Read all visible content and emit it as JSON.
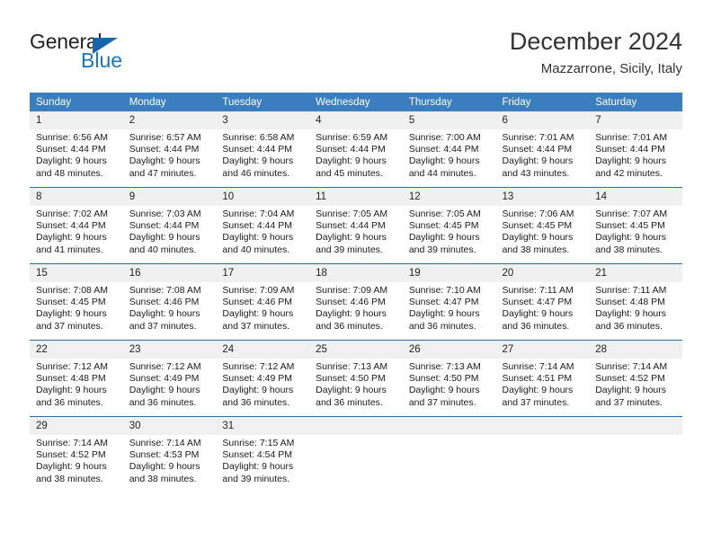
{
  "branding": {
    "name_top": "General",
    "name_bottom": "Blue",
    "accent_color": "#1b75bb",
    "triangle_color": "#1566ac"
  },
  "header": {
    "title": "December 2024",
    "location": "Mazzarrone, Sicily, Italy"
  },
  "theme": {
    "header_row_background": "#3a7ebf",
    "header_row_text": "#ffffff",
    "daynum_background": "#f0f0f0",
    "week_divider": "#2e6da4",
    "page_background": "#ffffff"
  },
  "weekday_headers": [
    "Sunday",
    "Monday",
    "Tuesday",
    "Wednesday",
    "Thursday",
    "Friday",
    "Saturday"
  ],
  "days": [
    {
      "day": "1",
      "sunrise": "Sunrise: 6:56 AM",
      "sunset": "Sunset: 4:44 PM",
      "daylight_1": "Daylight: 9 hours",
      "daylight_2": "and 48 minutes."
    },
    {
      "day": "2",
      "sunrise": "Sunrise: 6:57 AM",
      "sunset": "Sunset: 4:44 PM",
      "daylight_1": "Daylight: 9 hours",
      "daylight_2": "and 47 minutes."
    },
    {
      "day": "3",
      "sunrise": "Sunrise: 6:58 AM",
      "sunset": "Sunset: 4:44 PM",
      "daylight_1": "Daylight: 9 hours",
      "daylight_2": "and 46 minutes."
    },
    {
      "day": "4",
      "sunrise": "Sunrise: 6:59 AM",
      "sunset": "Sunset: 4:44 PM",
      "daylight_1": "Daylight: 9 hours",
      "daylight_2": "and 45 minutes."
    },
    {
      "day": "5",
      "sunrise": "Sunrise: 7:00 AM",
      "sunset": "Sunset: 4:44 PM",
      "daylight_1": "Daylight: 9 hours",
      "daylight_2": "and 44 minutes."
    },
    {
      "day": "6",
      "sunrise": "Sunrise: 7:01 AM",
      "sunset": "Sunset: 4:44 PM",
      "daylight_1": "Daylight: 9 hours",
      "daylight_2": "and 43 minutes."
    },
    {
      "day": "7",
      "sunrise": "Sunrise: 7:01 AM",
      "sunset": "Sunset: 4:44 PM",
      "daylight_1": "Daylight: 9 hours",
      "daylight_2": "and 42 minutes."
    },
    {
      "day": "8",
      "sunrise": "Sunrise: 7:02 AM",
      "sunset": "Sunset: 4:44 PM",
      "daylight_1": "Daylight: 9 hours",
      "daylight_2": "and 41 minutes."
    },
    {
      "day": "9",
      "sunrise": "Sunrise: 7:03 AM",
      "sunset": "Sunset: 4:44 PM",
      "daylight_1": "Daylight: 9 hours",
      "daylight_2": "and 40 minutes."
    },
    {
      "day": "10",
      "sunrise": "Sunrise: 7:04 AM",
      "sunset": "Sunset: 4:44 PM",
      "daylight_1": "Daylight: 9 hours",
      "daylight_2": "and 40 minutes."
    },
    {
      "day": "11",
      "sunrise": "Sunrise: 7:05 AM",
      "sunset": "Sunset: 4:44 PM",
      "daylight_1": "Daylight: 9 hours",
      "daylight_2": "and 39 minutes."
    },
    {
      "day": "12",
      "sunrise": "Sunrise: 7:05 AM",
      "sunset": "Sunset: 4:45 PM",
      "daylight_1": "Daylight: 9 hours",
      "daylight_2": "and 39 minutes."
    },
    {
      "day": "13",
      "sunrise": "Sunrise: 7:06 AM",
      "sunset": "Sunset: 4:45 PM",
      "daylight_1": "Daylight: 9 hours",
      "daylight_2": "and 38 minutes."
    },
    {
      "day": "14",
      "sunrise": "Sunrise: 7:07 AM",
      "sunset": "Sunset: 4:45 PM",
      "daylight_1": "Daylight: 9 hours",
      "daylight_2": "and 38 minutes."
    },
    {
      "day": "15",
      "sunrise": "Sunrise: 7:08 AM",
      "sunset": "Sunset: 4:45 PM",
      "daylight_1": "Daylight: 9 hours",
      "daylight_2": "and 37 minutes."
    },
    {
      "day": "16",
      "sunrise": "Sunrise: 7:08 AM",
      "sunset": "Sunset: 4:46 PM",
      "daylight_1": "Daylight: 9 hours",
      "daylight_2": "and 37 minutes."
    },
    {
      "day": "17",
      "sunrise": "Sunrise: 7:09 AM",
      "sunset": "Sunset: 4:46 PM",
      "daylight_1": "Daylight: 9 hours",
      "daylight_2": "and 37 minutes."
    },
    {
      "day": "18",
      "sunrise": "Sunrise: 7:09 AM",
      "sunset": "Sunset: 4:46 PM",
      "daylight_1": "Daylight: 9 hours",
      "daylight_2": "and 36 minutes."
    },
    {
      "day": "19",
      "sunrise": "Sunrise: 7:10 AM",
      "sunset": "Sunset: 4:47 PM",
      "daylight_1": "Daylight: 9 hours",
      "daylight_2": "and 36 minutes."
    },
    {
      "day": "20",
      "sunrise": "Sunrise: 7:11 AM",
      "sunset": "Sunset: 4:47 PM",
      "daylight_1": "Daylight: 9 hours",
      "daylight_2": "and 36 minutes."
    },
    {
      "day": "21",
      "sunrise": "Sunrise: 7:11 AM",
      "sunset": "Sunset: 4:48 PM",
      "daylight_1": "Daylight: 9 hours",
      "daylight_2": "and 36 minutes."
    },
    {
      "day": "22",
      "sunrise": "Sunrise: 7:12 AM",
      "sunset": "Sunset: 4:48 PM",
      "daylight_1": "Daylight: 9 hours",
      "daylight_2": "and 36 minutes."
    },
    {
      "day": "23",
      "sunrise": "Sunrise: 7:12 AM",
      "sunset": "Sunset: 4:49 PM",
      "daylight_1": "Daylight: 9 hours",
      "daylight_2": "and 36 minutes."
    },
    {
      "day": "24",
      "sunrise": "Sunrise: 7:12 AM",
      "sunset": "Sunset: 4:49 PM",
      "daylight_1": "Daylight: 9 hours",
      "daylight_2": "and 36 minutes."
    },
    {
      "day": "25",
      "sunrise": "Sunrise: 7:13 AM",
      "sunset": "Sunset: 4:50 PM",
      "daylight_1": "Daylight: 9 hours",
      "daylight_2": "and 36 minutes."
    },
    {
      "day": "26",
      "sunrise": "Sunrise: 7:13 AM",
      "sunset": "Sunset: 4:50 PM",
      "daylight_1": "Daylight: 9 hours",
      "daylight_2": "and 37 minutes."
    },
    {
      "day": "27",
      "sunrise": "Sunrise: 7:14 AM",
      "sunset": "Sunset: 4:51 PM",
      "daylight_1": "Daylight: 9 hours",
      "daylight_2": "and 37 minutes."
    },
    {
      "day": "28",
      "sunrise": "Sunrise: 7:14 AM",
      "sunset": "Sunset: 4:52 PM",
      "daylight_1": "Daylight: 9 hours",
      "daylight_2": "and 37 minutes."
    },
    {
      "day": "29",
      "sunrise": "Sunrise: 7:14 AM",
      "sunset": "Sunset: 4:52 PM",
      "daylight_1": "Daylight: 9 hours",
      "daylight_2": "and 38 minutes."
    },
    {
      "day": "30",
      "sunrise": "Sunrise: 7:14 AM",
      "sunset": "Sunset: 4:53 PM",
      "daylight_1": "Daylight: 9 hours",
      "daylight_2": "and 38 minutes."
    },
    {
      "day": "31",
      "sunrise": "Sunrise: 7:15 AM",
      "sunset": "Sunset: 4:54 PM",
      "daylight_1": "Daylight: 9 hours",
      "daylight_2": "and 39 minutes."
    }
  ]
}
